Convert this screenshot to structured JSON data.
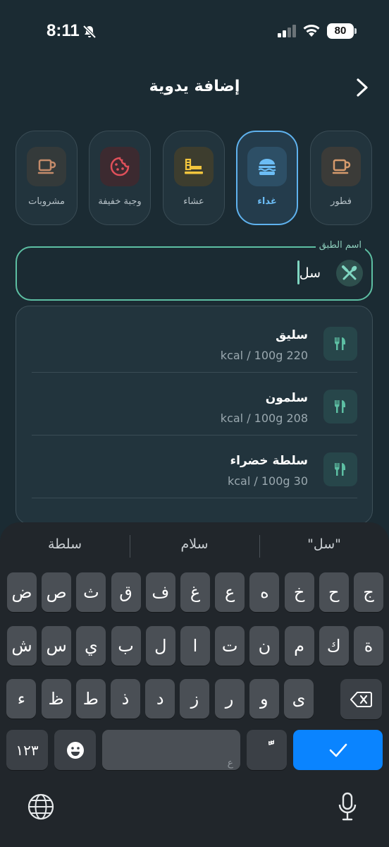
{
  "status_bar": {
    "time": "8:11",
    "battery": "80"
  },
  "header": {
    "title": "إضافة يدوية"
  },
  "categories": [
    {
      "label": "فطور",
      "icon": "coffee-cup-icon",
      "color": "#d59a6c",
      "selected": false
    },
    {
      "label": "غداء",
      "icon": "burger-icon",
      "color": "#6cbdf5",
      "selected": true
    },
    {
      "label": "عشاء",
      "icon": "dinner-plate-icon",
      "color": "#f2c53d",
      "selected": false
    },
    {
      "label": "وجبة خفيفة",
      "icon": "cookie-icon",
      "color": "#e0505a",
      "selected": false
    },
    {
      "label": "مشروبات",
      "icon": "drink-cup-icon",
      "color": "#c48b6a",
      "selected": false
    }
  ],
  "dish_field": {
    "label": "اسم الطبق",
    "value": "سل"
  },
  "suggestions": [
    {
      "name": "سليق",
      "calories": "kcal / 100g 220"
    },
    {
      "name": "سلمون",
      "calories": "kcal / 100g 208"
    },
    {
      "name": "سلطة خضراء",
      "calories": "kcal / 100g 30"
    }
  ],
  "keyboard": {
    "predictions": [
      "\"سل\"",
      "سلام",
      "سلطة"
    ],
    "row1": [
      "ج",
      "ح",
      "خ",
      "ه",
      "ع",
      "غ",
      "ف",
      "ق",
      "ث",
      "ص",
      "ض"
    ],
    "row2": [
      "ة",
      "ك",
      "م",
      "ن",
      "ت",
      "ا",
      "ل",
      "ب",
      "ي",
      "س",
      "ش"
    ],
    "row3": [
      "ى",
      "و",
      "ر",
      "ز",
      "د",
      "ذ",
      "ط",
      "ظ",
      "ء"
    ],
    "numbers_label": "١٢٣",
    "space_hint": "ع",
    "diacritic_label": "ًّ",
    "accent_color": "#0a84ff"
  }
}
